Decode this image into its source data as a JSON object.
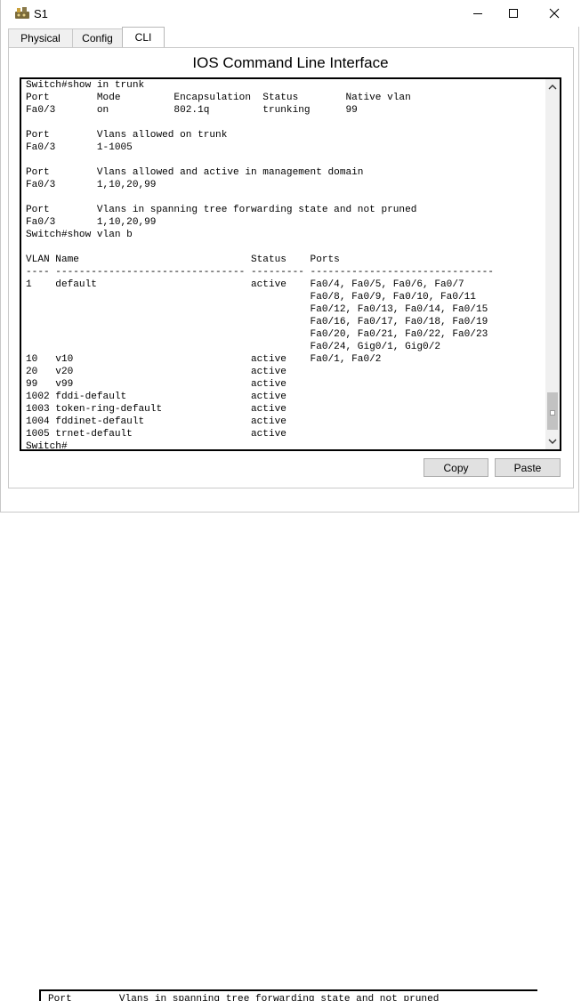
{
  "window": {
    "title": "S1",
    "controls": {
      "minimize": "—",
      "maximize": "☐",
      "close": "✕"
    }
  },
  "tabs": [
    {
      "label": "Physical",
      "active": false
    },
    {
      "label": "Config",
      "active": false
    },
    {
      "label": "CLI",
      "active": true
    }
  ],
  "cli": {
    "heading": "IOS Command Line Interface",
    "lines": [
      "Switch#show in trunk",
      "Port        Mode         Encapsulation  Status        Native vlan",
      "Fa0/3       on           802.1q         trunking      99",
      "",
      "Port        Vlans allowed on trunk",
      "Fa0/3       1-1005",
      "",
      "Port        Vlans allowed and active in management domain",
      "Fa0/3       1,10,20,99",
      "",
      "Port        Vlans in spanning tree forwarding state and not pruned",
      "Fa0/3       1,10,20,99",
      "Switch#show vlan b",
      "",
      "VLAN Name                             Status    Ports",
      "---- -------------------------------- --------- -------------------------------",
      "1    default                          active    Fa0/4, Fa0/5, Fa0/6, Fa0/7",
      "                                                Fa0/8, Fa0/9, Fa0/10, Fa0/11",
      "                                                Fa0/12, Fa0/13, Fa0/14, Fa0/15",
      "                                                Fa0/16, Fa0/17, Fa0/18, Fa0/19",
      "                                                Fa0/20, Fa0/21, Fa0/22, Fa0/23",
      "                                                Fa0/24, Gig0/1, Gig0/2",
      "10   v10                              active    Fa0/1, Fa0/2",
      "20   v20                              active",
      "99   v99                              active",
      "1002 fddi-default                     active",
      "1003 token-ring-default               active",
      "1004 fddinet-default                  active",
      "1005 trnet-default                    active",
      "Switch#"
    ]
  },
  "buttons": {
    "copy": "Copy",
    "paste": "Paste"
  },
  "background_window": {
    "line": "Port        Vlans in spanning tree forwarding state and not pruned"
  },
  "icons": {
    "app": "packet-tracer-icon",
    "scroll_up": "chevron-up-icon",
    "scroll_down": "chevron-down-icon"
  }
}
